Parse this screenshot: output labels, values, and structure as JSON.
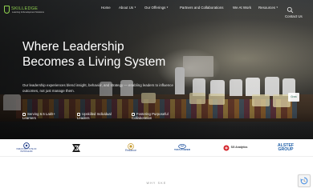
{
  "brand": {
    "name": "SKILLEDGE",
    "tagline": "Learning & Development Solutions"
  },
  "nav": {
    "items": [
      {
        "label": "Home",
        "has_dropdown": false
      },
      {
        "label": "About Us",
        "has_dropdown": true
      },
      {
        "label": "Our Offerings",
        "has_dropdown": true
      },
      {
        "label": "Partners and Collaborations",
        "has_dropdown": false
      },
      {
        "label": "We At Work",
        "has_dropdown": false
      },
      {
        "label": "Resources",
        "has_dropdown": true
      },
      {
        "label": "Contact Us",
        "has_dropdown": false
      }
    ],
    "search_icon": "search-icon"
  },
  "hero": {
    "headline_line1": "Where Leadership",
    "headline_line2": "Becomes a Living System",
    "subtext": "Our leadership experiences blend insight, behavior, and strategy — enabling leaders to influence outcomes, not just manage them.",
    "stats": [
      {
        "label": "Serving 6.5 Lakh+ Learners"
      },
      {
        "label": "Upskilled Individual Leaders"
      },
      {
        "label": "Fostering Purposeful Collaboration"
      }
    ],
    "side_tab": "Grow"
  },
  "clients": [
    {
      "name": "INDIAN INSTITUTE OF PETROLEUM",
      "color": "#1f3d8a"
    },
    {
      "name": "CUMMINS",
      "color": "#1b1b1b"
    },
    {
      "name": "Reliance",
      "color": "#2b4a8b"
    },
    {
      "name": "TATA POWER",
      "color": "#1c4f9c"
    },
    {
      "name": "SG Analytics",
      "color": "#d4242b"
    },
    {
      "name": "ALSTEF GROUP",
      "color": "#1f5fa8"
    }
  ],
  "section": {
    "eyebrow": "WHY SKE"
  },
  "colors": {
    "brand_green": "#8fd14f",
    "nav_text": "#f2f2f2"
  }
}
